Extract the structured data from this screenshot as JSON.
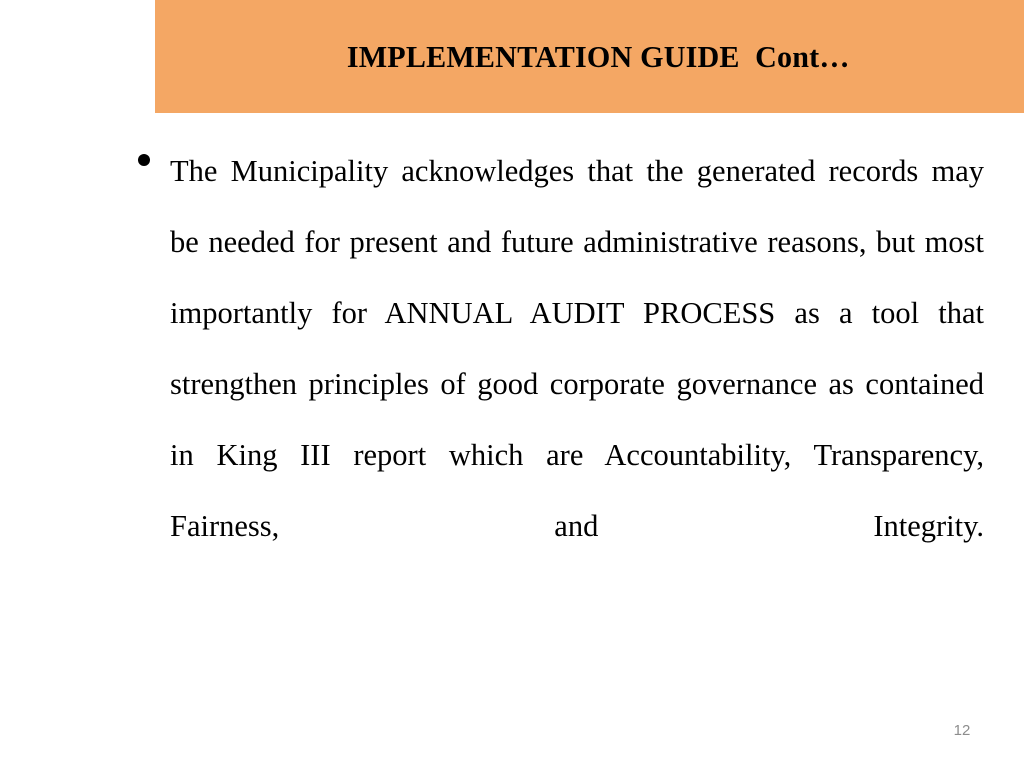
{
  "slide": {
    "title": "IMPLEMENTATION GUIDE  Cont…",
    "background_color": "#ffffff",
    "banner_color": "#f4a764",
    "text_color": "#000000",
    "page_number": "12",
    "page_number_color": "#8d8d8d",
    "bullet_glyph": "•",
    "body": {
      "bullet_1": "The Municipality acknowledges that the generated records may be needed for present and future administrative reasons, but most importantly for ANNUAL AUDIT PROCESS as a tool that strengthen principles of good corporate governance as contained in King III report which are Accountability, Transparency, Fairness, and Integrity.",
      "lines": [
        "The Municipality acknowledges that the generated",
        "records may be needed for present and future",
        "administrative reasons, but most importantly for",
        "ANNUAL AUDIT PROCESS as a tool that",
        "strengthen principles of good corporate",
        "governance as contained in King III report which",
        "are Accountability, Transparency, Fairness, and",
        "Integrity."
      ]
    }
  }
}
